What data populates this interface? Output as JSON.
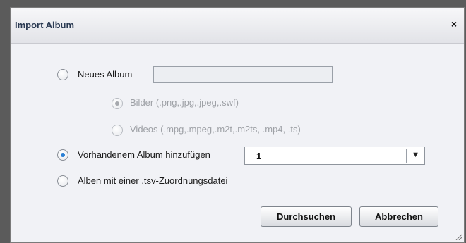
{
  "dialog": {
    "title": "Import Album",
    "close_glyph": "×",
    "options": {
      "new_album": {
        "label": "Neues Album",
        "checked": false,
        "input_value": ""
      },
      "images": {
        "label": "Bilder (.png,.jpg,.jpeg,.swf)",
        "checked": true,
        "disabled": true
      },
      "videos": {
        "label": "Videos (.mpg,.mpeg,.m2t,.m2ts, .mp4, .ts)",
        "checked": false,
        "disabled": true
      },
      "existing_album": {
        "label": "Vorhandenem Album hinzufügen",
        "checked": true,
        "selected_value": "1",
        "arrow_glyph": "▼"
      },
      "tsv_albums": {
        "label": "Alben mit einer .tsv-Zuordnungsdatei",
        "checked": false
      }
    },
    "buttons": {
      "browse": "Durchsuchen",
      "cancel": "Abbrechen"
    },
    "colors": {
      "accent": "#2a7fd4",
      "title_text": "#2a3a52"
    }
  }
}
